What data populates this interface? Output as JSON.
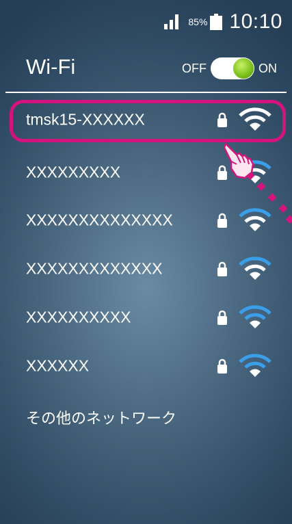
{
  "status_bar": {
    "signal_icon": "signal-bars-icon",
    "battery_percent": "85%",
    "battery_icon": "battery-icon",
    "time": "10:10"
  },
  "header": {
    "title": "Wi-Fi",
    "toggle_off_label": "OFF",
    "toggle_on_label": "ON",
    "toggle_state": "on",
    "toggle_knob_color": "#7fc31c"
  },
  "networks": [
    {
      "ssid": "tmsk15-XXXXXX",
      "secured": true,
      "signal_color": "#ffffff",
      "selected": true
    },
    {
      "ssid": "XXXXXXXXX",
      "secured": true,
      "signal_color": "#3a9ee8",
      "selected": false
    },
    {
      "ssid": "XXXXXXXXXXXXXX",
      "secured": true,
      "signal_color": "#3a9ee8",
      "selected": false
    },
    {
      "ssid": "XXXXXXXXXXXXX",
      "secured": true,
      "signal_color": "#3a9ee8",
      "selected": false
    },
    {
      "ssid": "XXXXXXXXXX",
      "secured": true,
      "signal_color": "#3a9ee8",
      "selected": false
    },
    {
      "ssid": "XXXXXX",
      "secured": true,
      "signal_color": "#3a9ee8",
      "selected": false
    }
  ],
  "other_networks_label": "その他のネットワーク",
  "annotation": {
    "highlight_color": "#d4137f",
    "pointer_icon": "pointing-hand-icon"
  }
}
